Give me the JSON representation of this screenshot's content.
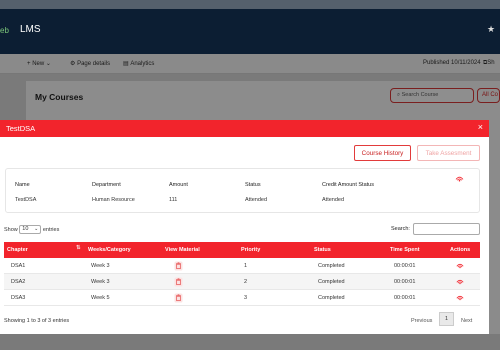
{
  "app": {
    "brand_fragment": "eb",
    "title": "LMS",
    "star": "★"
  },
  "toolbar": {
    "new_label": "New",
    "page_details_label": "Page details",
    "analytics_label": "Analytics",
    "published_label": "Published 10/11/2024",
    "share_fragment": "Sh"
  },
  "page": {
    "heading": "My Courses",
    "search_placeholder": "Search Course",
    "all_courses_fragment": "All Co"
  },
  "modal": {
    "title": "TestDSA",
    "close": "×",
    "course_history_label": "Course History",
    "take_assessment_label": "Take Assesment",
    "info": {
      "headers": [
        "Name",
        "Department",
        "Amount",
        "Status",
        "Credit Amount Status"
      ],
      "values": [
        "TestDSA",
        "Human Resource",
        "111",
        "Attended",
        "Attended"
      ]
    },
    "show_label": "Show",
    "entries_value": "10",
    "entries_label": "entries",
    "search_label": "Search:",
    "table": {
      "columns": [
        "Chapter",
        "Weeks/Category",
        "View Material",
        "Priority",
        "Status",
        "Time Spent",
        "Actions"
      ],
      "rows": [
        {
          "chapter": "DSA1",
          "week": "Week 3",
          "priority": "1",
          "status": "Completed",
          "time": "00:00:01"
        },
        {
          "chapter": "DSA2",
          "week": "Week 3",
          "priority": "2",
          "status": "Completed",
          "time": "00:00:01"
        },
        {
          "chapter": "DSA3",
          "week": "Week 5",
          "priority": "3",
          "status": "Completed",
          "time": "00:00:01"
        }
      ]
    },
    "footer": {
      "info": "Showing 1 to 3 of 3 entries",
      "previous": "Previous",
      "page": "1",
      "next": "Next"
    }
  },
  "colors": {
    "accent": "#f2242c",
    "header_bg": "#0c1e33"
  }
}
